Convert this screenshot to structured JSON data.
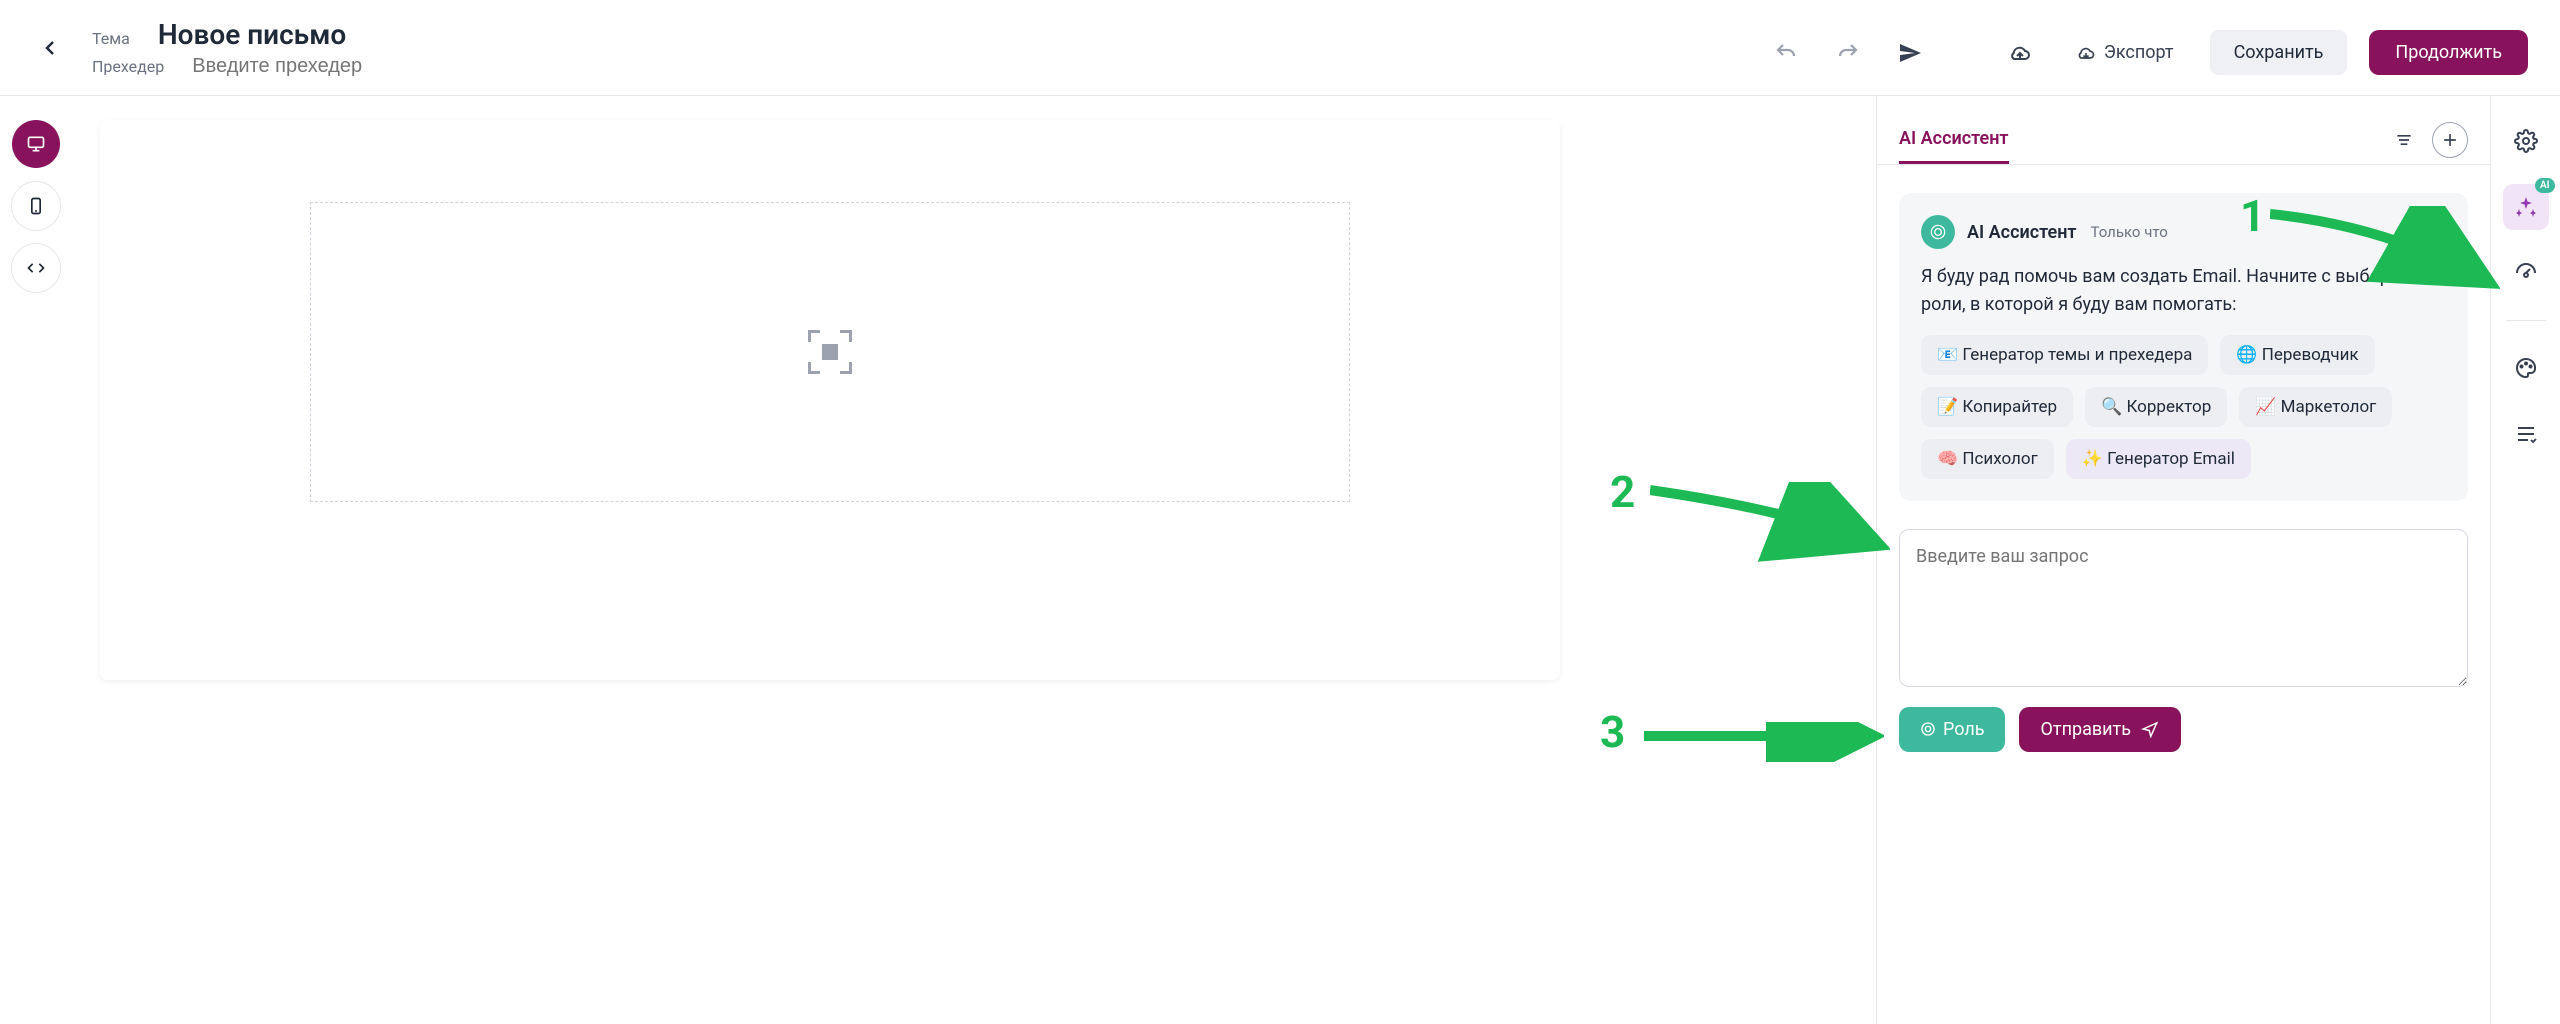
{
  "header": {
    "subject_label": "Тема",
    "subject_value": "Новое письмо",
    "preheader_label": "Прехедер",
    "preheader_placeholder": "Введите прехедер",
    "export_label": "Экспорт",
    "save_label": "Сохранить",
    "continue_label": "Продолжить"
  },
  "ai_panel": {
    "tab_label": "AI Ассистент",
    "msg_name": "AI Ассистент",
    "msg_time": "Только что",
    "msg_text": "Я буду рад помочь вам создать Email. Начните с выбора роли, в которой я буду вам помогать:",
    "roles": {
      "r0": "📧 Генератор темы и прехедера",
      "r1": "🌐 Переводчик",
      "r2": "📝 Копирайтер",
      "r3": "🔍 Корректор",
      "r4": "📈 Маркетолог",
      "r5": "🧠 Психолог",
      "r6": "✨ Генератор Email"
    },
    "prompt_placeholder": "Введите ваш запрос",
    "role_button": "Роль",
    "send_button": "Отправить"
  },
  "annotations": {
    "n1": "1",
    "n2": "2",
    "n3": "3"
  }
}
